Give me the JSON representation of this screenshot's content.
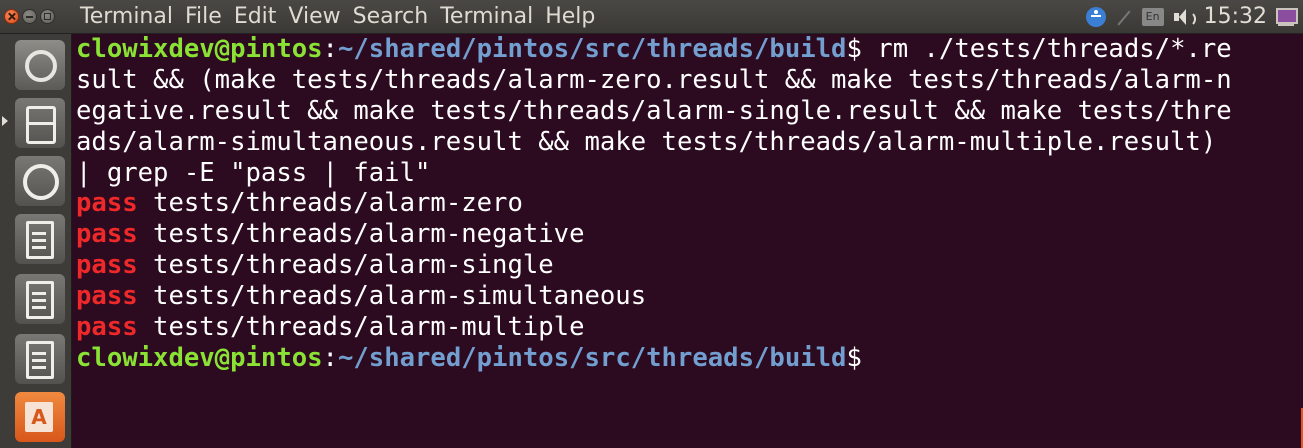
{
  "menubar": {
    "items": [
      "Terminal",
      "File",
      "Edit",
      "View",
      "Search",
      "Terminal",
      "Help"
    ]
  },
  "indicators": {
    "language": "En",
    "clock": "15:32"
  },
  "launcher": {
    "icons": [
      "ubuntu-dash-icon",
      "files-icon",
      "firefox-icon",
      "writer-icon",
      "calc-icon",
      "impress-icon",
      "software-center-icon"
    ]
  },
  "terminal": {
    "prompt": {
      "user_host": "clowixdev@pintos",
      "separator": ":",
      "path": "~/shared/pintos/src/threads/build",
      "symbol": "$"
    },
    "command_lines": [
      " rm ./tests/threads/*.re",
      "sult && (make tests/threads/alarm-zero.result && make tests/threads/alarm-n",
      "egative.result && make tests/threads/alarm-single.result && make tests/thre",
      "ads/alarm-simultaneous.result && make tests/threads/alarm-multiple.result)",
      "| grep -E \"pass | fail\""
    ],
    "results": [
      {
        "status": "pass",
        "test": " tests/threads/alarm-zero"
      },
      {
        "status": "pass",
        "test": " tests/threads/alarm-negative"
      },
      {
        "status": "pass",
        "test": " tests/threads/alarm-single"
      },
      {
        "status": "pass",
        "test": " tests/threads/alarm-simultaneous"
      },
      {
        "status": "pass",
        "test": " tests/threads/alarm-multiple"
      }
    ]
  },
  "colors": {
    "terminal_bg": "#2c0a20",
    "prompt_user": "#8ae234",
    "prompt_path": "#729fcf",
    "pass": "#ef2929",
    "text": "#ffffff"
  }
}
